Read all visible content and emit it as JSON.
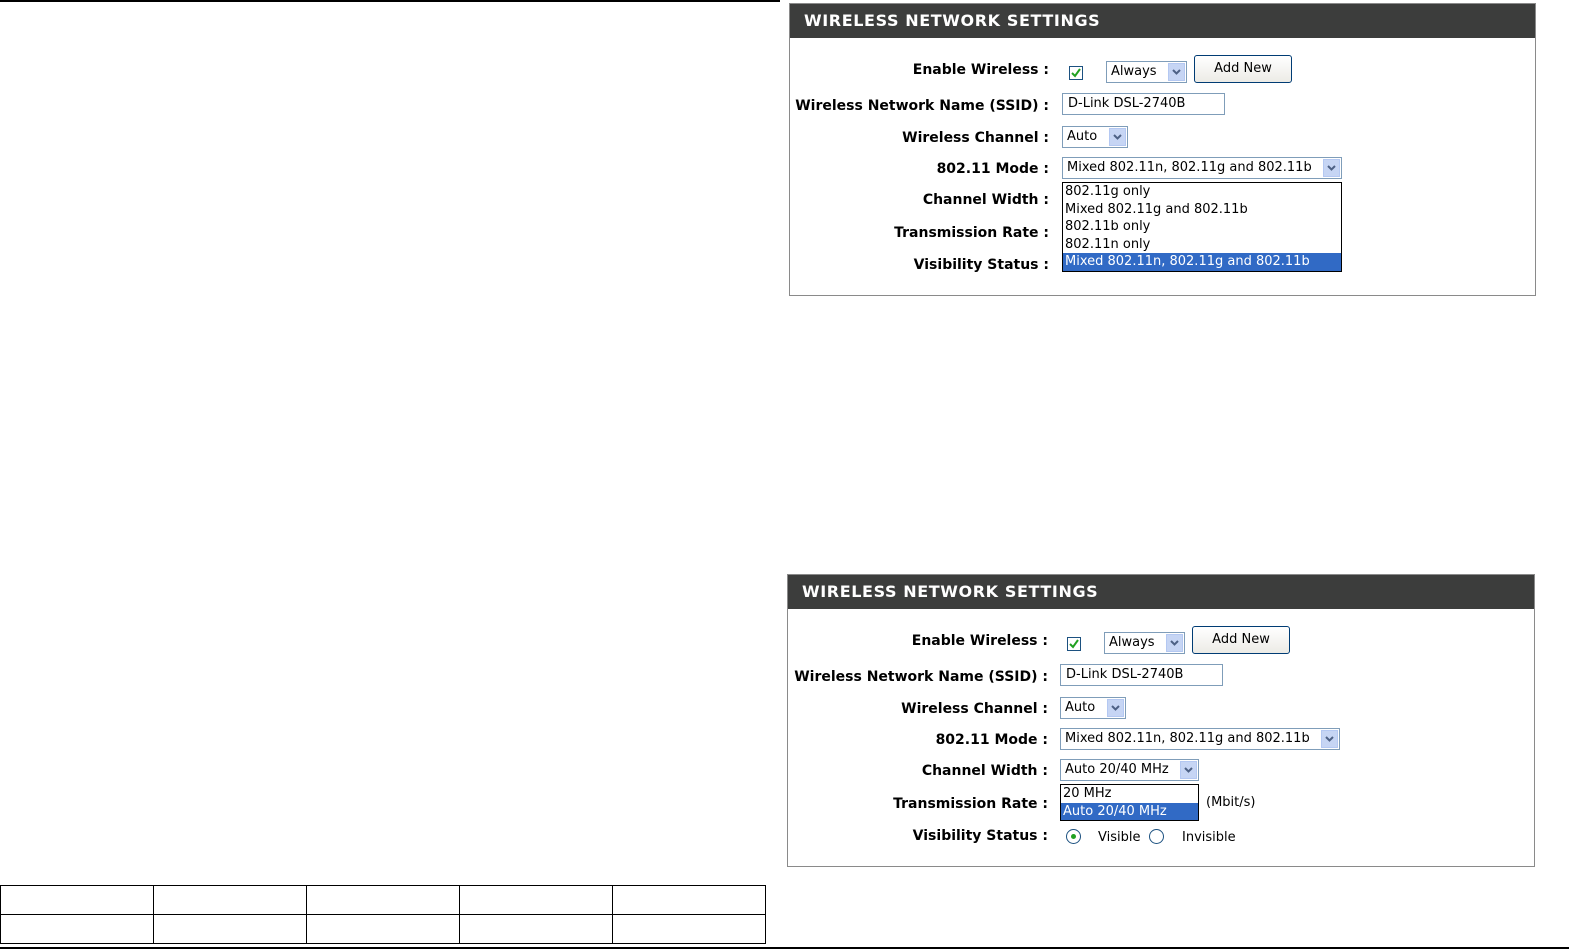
{
  "panels": [
    {
      "title": "WIRELESS NETWORK SETTINGS",
      "enable_wireless": {
        "label": "Enable Wireless :",
        "checked": true,
        "schedule": "Always",
        "add_new": "Add New"
      },
      "ssid": {
        "label": "Wireless Network Name (SSID) :",
        "value": "D-Link DSL-2740B"
      },
      "channel": {
        "label": "Wireless Channel :",
        "value": "Auto"
      },
      "mode": {
        "label": "802.11 Mode :",
        "value": "Mixed 802.11n, 802.11g and 802.11b"
      },
      "channel_width": {
        "label": "Channel Width :"
      },
      "transmission_rate": {
        "label": "Transmission Rate :"
      },
      "visibility": {
        "label": "Visibility Status :"
      },
      "open_dropdown": {
        "for": "802.11 Mode",
        "options": [
          "802.11g only",
          "Mixed 802.11g and 802.11b",
          "802.11b only",
          "802.11n only",
          "Mixed 802.11n, 802.11g and 802.11b"
        ],
        "selected_index": 4
      }
    },
    {
      "title": "WIRELESS NETWORK SETTINGS",
      "enable_wireless": {
        "label": "Enable Wireless :",
        "checked": true,
        "schedule": "Always",
        "add_new": "Add New"
      },
      "ssid": {
        "label": "Wireless Network Name (SSID) :",
        "value": "D-Link DSL-2740B"
      },
      "channel": {
        "label": "Wireless Channel :",
        "value": "Auto"
      },
      "mode": {
        "label": "802.11 Mode :",
        "value": "Mixed 802.11n, 802.11g and 802.11b"
      },
      "channel_width": {
        "label": "Channel Width :",
        "value": "Auto 20/40 MHz"
      },
      "transmission_rate": {
        "label": "Transmission Rate :",
        "unit": "(Mbit/s)"
      },
      "visibility": {
        "label": "Visibility Status :",
        "options": [
          "Visible",
          "Invisible"
        ],
        "selected": "Visible"
      },
      "open_dropdown": {
        "for": "Channel Width",
        "options": [
          "20 MHz",
          "Auto 20/40 MHz"
        ],
        "selected_index": 1
      }
    }
  ],
  "colors": {
    "header_bg": "#3c3d3c",
    "highlight": "#316ac5",
    "radio_dot": "#21a121"
  }
}
